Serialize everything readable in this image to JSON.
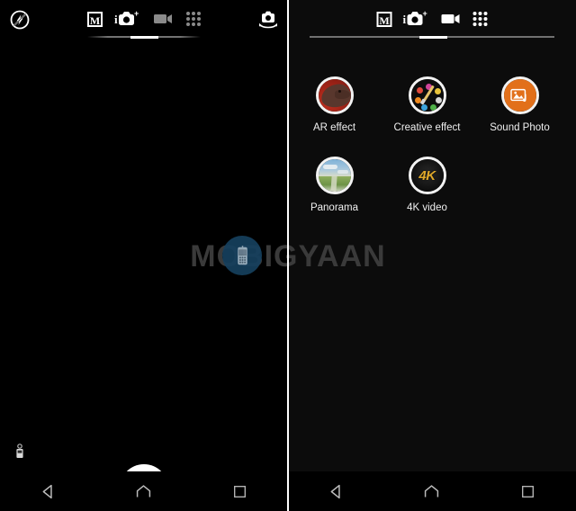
{
  "app": {
    "name": "Camera",
    "watermark_text": "MOBIGYAAN",
    "watermark_color": "#3a3a3a",
    "badge_color": "#16405e",
    "accent_orange": "#e2701a",
    "accent_gold": "#e0a92a"
  },
  "left_panel": {
    "name": "camera-viewfinder",
    "flash_icon": "flash-off-icon",
    "switch_camera_icon": "camera-switch-icon",
    "level_icon": "level-indicator-icon",
    "settings_icon": "gear-icon",
    "shutter_icon": "camera-icon",
    "gallery_icon": "gallery-thumbnail",
    "tabs": [
      {
        "id": "manual",
        "label": "M",
        "icon": "manual-mode-icon",
        "selected": false
      },
      {
        "id": "superior-auto",
        "label": "",
        "icon": "superior-auto-camera-icon",
        "selected": true
      },
      {
        "id": "video",
        "label": "",
        "icon": "video-camera-icon",
        "selected": false
      },
      {
        "id": "apps",
        "label": "",
        "icon": "apps-grid-icon",
        "selected": false
      }
    ]
  },
  "right_panel": {
    "name": "camera-apps-list",
    "tabs": [
      {
        "id": "manual",
        "label": "M",
        "icon": "manual-mode-icon",
        "selected": false
      },
      {
        "id": "superior-auto",
        "label": "",
        "icon": "superior-auto-camera-icon",
        "selected": false
      },
      {
        "id": "video",
        "label": "",
        "icon": "video-camera-icon",
        "selected": false
      },
      {
        "id": "apps",
        "label": "",
        "icon": "apps-grid-icon",
        "selected": true
      }
    ],
    "modes": [
      {
        "id": "ar-effect",
        "label": "AR effect",
        "icon": "ar-effect-icon"
      },
      {
        "id": "creative-effect",
        "label": "Creative effect",
        "icon": "creative-effect-palette-icon"
      },
      {
        "id": "sound-photo",
        "label": "Sound Photo",
        "icon": "sound-photo-icon"
      },
      {
        "id": "panorama",
        "label": "Panorama",
        "icon": "panorama-icon"
      },
      {
        "id": "4k-video",
        "label": "4K video",
        "icon": "4k-video-icon",
        "badge_text": "4K"
      }
    ]
  },
  "navbar": {
    "back": "back-button",
    "home": "home-button",
    "recents": "recents-button"
  }
}
